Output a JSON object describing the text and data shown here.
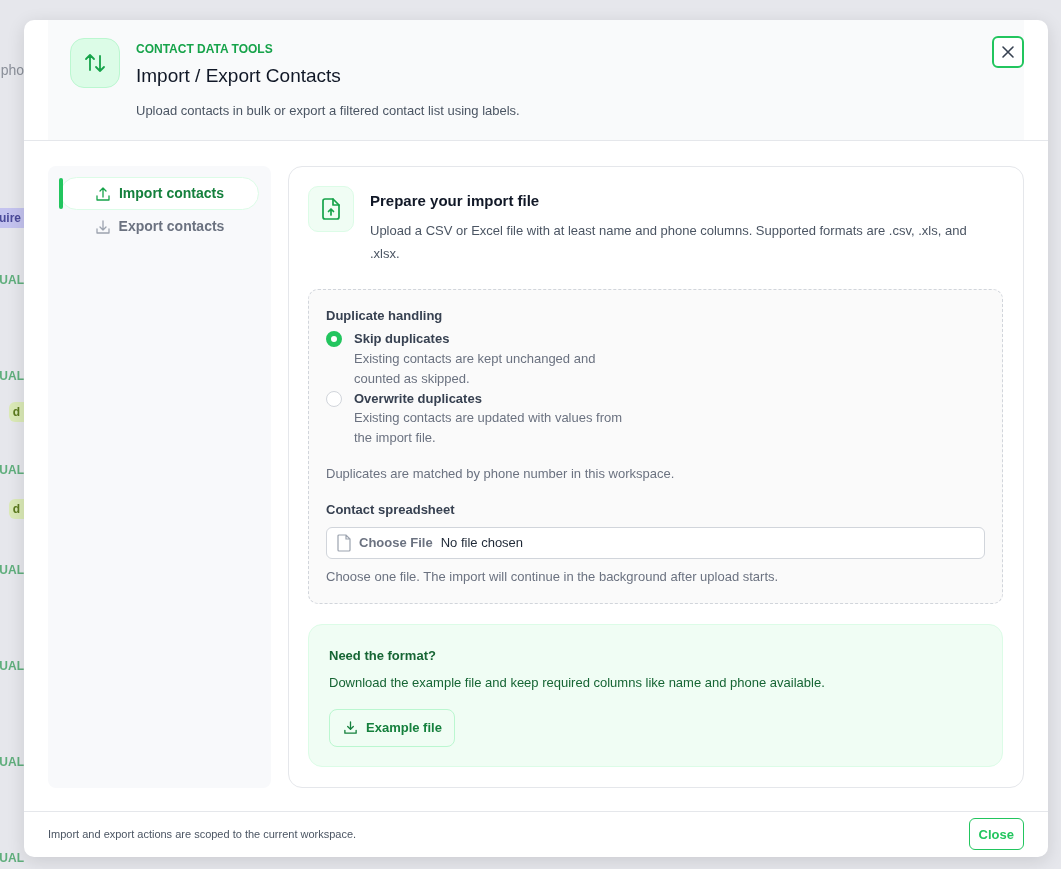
{
  "background": {
    "fragments": [
      {
        "kind": "placeholder",
        "text": "pho"
      },
      {
        "kind": "label",
        "text": "uire"
      },
      {
        "kind": "status",
        "text": "UAL"
      },
      {
        "kind": "status",
        "text": "UAL"
      },
      {
        "kind": "tag",
        "text": "d"
      },
      {
        "kind": "status",
        "text": "UAL"
      },
      {
        "kind": "tag",
        "text": "d"
      },
      {
        "kind": "status",
        "text": "UAL"
      },
      {
        "kind": "status",
        "text": "UAL"
      },
      {
        "kind": "status",
        "text": "UAL"
      },
      {
        "kind": "status",
        "text": "UAL"
      }
    ]
  },
  "dialog": {
    "eyebrow": "CONTACT DATA TOOLS",
    "title": "Import / Export Contacts",
    "subtitle": "Upload contacts in bulk or export a filtered contact list using labels.",
    "tabs": [
      {
        "label": "Import contacts",
        "selected": true
      },
      {
        "label": "Export contacts",
        "selected": false
      }
    ],
    "panel": {
      "title": "Prepare your import file",
      "description": "Upload a CSV or Excel file with at least name and phone columns. Supported formats are .csv, .xls, and .xlsx.",
      "duplicate_handling": {
        "label": "Duplicate handling",
        "options": [
          {
            "label": "Skip duplicates",
            "description": "Existing contacts are kept unchanged and counted as skipped.",
            "selected": true
          },
          {
            "label": "Overwrite duplicates",
            "description": "Existing contacts are updated with values from the import file.",
            "selected": false
          }
        ],
        "note": "Duplicates are matched by phone number in this workspace."
      },
      "file_field": {
        "label": "Contact spreadsheet",
        "button": "Choose File",
        "value": "No file chosen",
        "help": "Choose one file. The import will continue in the background after upload starts."
      },
      "format_box": {
        "title": "Need the format?",
        "text": "Download the example file and keep required columns like name and phone available.",
        "button": "Example file"
      }
    },
    "footer": {
      "note": "Import and export actions are scoped to the current workspace.",
      "close_button": "Close"
    }
  }
}
